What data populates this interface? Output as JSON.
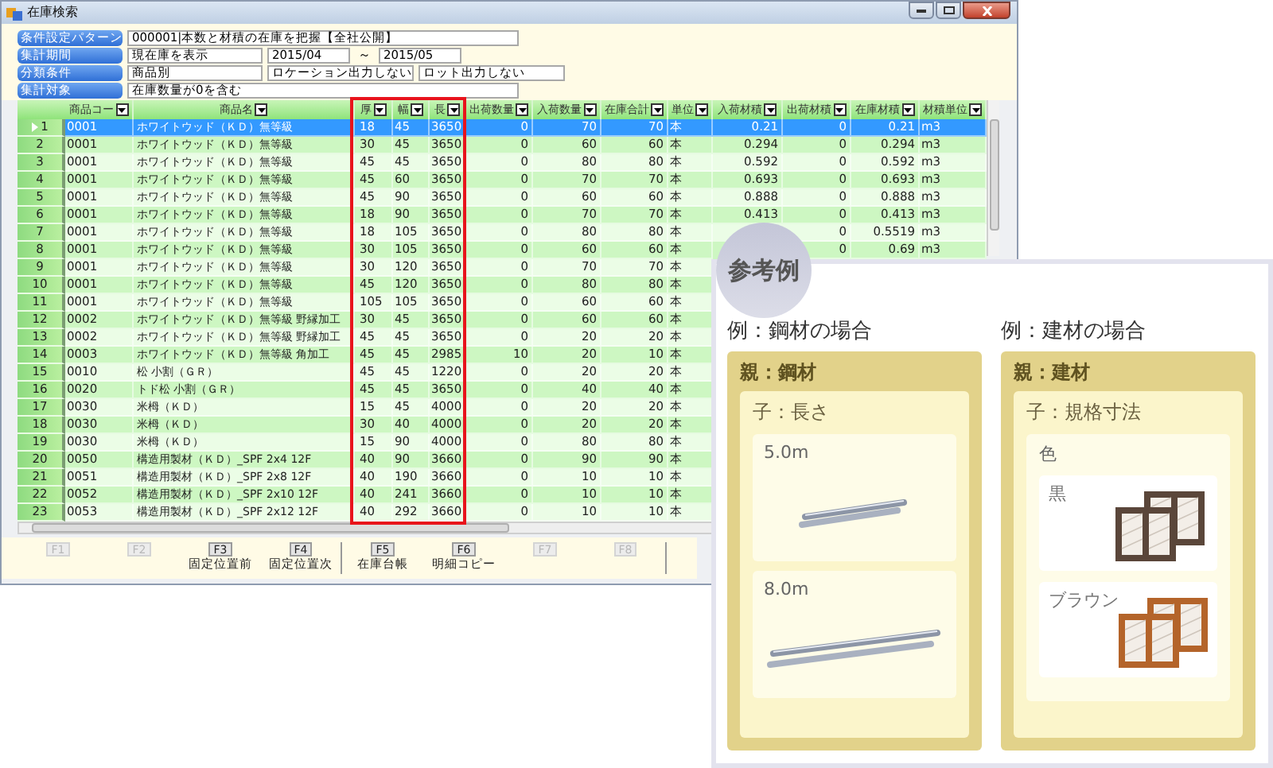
{
  "window": {
    "title": "在庫検索"
  },
  "conditions": [
    {
      "label": "条件設定パターン",
      "fields": [
        {
          "kind": "wide",
          "text": "000001|本数と材積の在庫を把握【全社公開】"
        }
      ]
    },
    {
      "label": "集計期間",
      "fields": [
        {
          "kind": "medium",
          "text": "現在庫を表示"
        },
        {
          "kind": "date",
          "text": "2015/04"
        },
        {
          "kind": "sep",
          "text": "～"
        },
        {
          "kind": "date",
          "text": "2015/05"
        }
      ]
    },
    {
      "label": "分類条件",
      "fields": [
        {
          "kind": "medium",
          "text": "商品別"
        },
        {
          "kind": "option",
          "text": "ロケーション出力しない"
        },
        {
          "kind": "option",
          "text": "ロット出力しない"
        }
      ]
    },
    {
      "label": "集計対象",
      "fields": [
        {
          "kind": "wide",
          "text": "在庫数量が0を含む"
        }
      ]
    }
  ],
  "table": {
    "columns": [
      {
        "label": "商品コー"
      },
      {
        "label": "商品名"
      },
      {
        "label": "厚"
      },
      {
        "label": "幅"
      },
      {
        "label": "長"
      },
      {
        "label": "出荷数量"
      },
      {
        "label": "入荷数量"
      },
      {
        "label": "在庫合計"
      },
      {
        "label": "単位"
      },
      {
        "label": "入荷材積"
      },
      {
        "label": "出荷材積"
      },
      {
        "label": "在庫材積"
      },
      {
        "label": "材積単位"
      }
    ],
    "rows": [
      {
        "no": "1",
        "selected": true,
        "cells": [
          "0001",
          "ホワイトウッド（ＫＤ）無等級",
          "18",
          "45",
          "3650",
          "0",
          "70",
          "70",
          "本",
          "0.21",
          "0",
          "0.21",
          "m3"
        ]
      },
      {
        "no": "2",
        "selected": false,
        "cells": [
          "0001",
          "ホワイトウッド（ＫＤ）無等級",
          "30",
          "45",
          "3650",
          "0",
          "60",
          "60",
          "本",
          "0.294",
          "0",
          "0.294",
          "m3"
        ]
      },
      {
        "no": "3",
        "selected": false,
        "cells": [
          "0001",
          "ホワイトウッド（ＫＤ）無等級",
          "45",
          "45",
          "3650",
          "0",
          "80",
          "80",
          "本",
          "0.592",
          "0",
          "0.592",
          "m3"
        ]
      },
      {
        "no": "4",
        "selected": false,
        "cells": [
          "0001",
          "ホワイトウッド（ＫＤ）無等級",
          "45",
          "60",
          "3650",
          "0",
          "70",
          "70",
          "本",
          "0.693",
          "0",
          "0.693",
          "m3"
        ]
      },
      {
        "no": "5",
        "selected": false,
        "cells": [
          "0001",
          "ホワイトウッド（ＫＤ）無等級",
          "45",
          "90",
          "3650",
          "0",
          "60",
          "60",
          "本",
          "0.888",
          "0",
          "0.888",
          "m3"
        ]
      },
      {
        "no": "6",
        "selected": false,
        "cells": [
          "0001",
          "ホワイトウッド（ＫＤ）無等級",
          "18",
          "90",
          "3650",
          "0",
          "70",
          "70",
          "本",
          "0.413",
          "0",
          "0.413",
          "m3"
        ]
      },
      {
        "no": "7",
        "selected": false,
        "cells": [
          "0001",
          "ホワイトウッド（ＫＤ）無等級",
          "18",
          "105",
          "3650",
          "0",
          "80",
          "80",
          "本",
          null,
          "0",
          "0.5519",
          "m3"
        ]
      },
      {
        "no": "8",
        "selected": false,
        "cells": [
          "0001",
          "ホワイトウッド（ＫＤ）無等級",
          "30",
          "105",
          "3650",
          "0",
          "60",
          "60",
          "本",
          null,
          "0",
          "0.69",
          "m3"
        ]
      },
      {
        "no": "9",
        "selected": false,
        "cells": [
          "0001",
          "ホワイトウッド（ＫＤ）無等級",
          "30",
          "120",
          "3650",
          "0",
          "70",
          "70",
          "本"
        ]
      },
      {
        "no": "10",
        "selected": false,
        "cells": [
          "0001",
          "ホワイトウッド（ＫＤ）無等級",
          "45",
          "120",
          "3650",
          "0",
          "80",
          "80",
          "本"
        ]
      },
      {
        "no": "11",
        "selected": false,
        "cells": [
          "0001",
          "ホワイトウッド（ＫＤ）無等級",
          "105",
          "105",
          "3650",
          "0",
          "60",
          "60",
          "本"
        ]
      },
      {
        "no": "12",
        "selected": false,
        "cells": [
          "0002",
          "ホワイトウッド（ＫＤ）無等級 野縁加工",
          "30",
          "45",
          "3650",
          "0",
          "60",
          "60",
          "本"
        ]
      },
      {
        "no": "13",
        "selected": false,
        "cells": [
          "0002",
          "ホワイトウッド（ＫＤ）無等級 野縁加工",
          "45",
          "45",
          "3650",
          "0",
          "20",
          "20",
          "本"
        ]
      },
      {
        "no": "14",
        "selected": false,
        "cells": [
          "0003",
          "ホワイトウッド（ＫＤ）無等級 角加工",
          "45",
          "45",
          "2985",
          "10",
          "20",
          "10",
          "本"
        ]
      },
      {
        "no": "15",
        "selected": false,
        "cells": [
          "0010",
          "松 小割（ＧＲ）",
          "45",
          "45",
          "1220",
          "0",
          "20",
          "20",
          "本"
        ]
      },
      {
        "no": "16",
        "selected": false,
        "cells": [
          "0020",
          "トド松 小割（ＧＲ）",
          "45",
          "45",
          "3650",
          "0",
          "40",
          "40",
          "本"
        ]
      },
      {
        "no": "17",
        "selected": false,
        "cells": [
          "0030",
          "米栂（ＫＤ）",
          "15",
          "45",
          "4000",
          "0",
          "20",
          "20",
          "本"
        ]
      },
      {
        "no": "18",
        "selected": false,
        "cells": [
          "0030",
          "米栂（ＫＤ）",
          "30",
          "40",
          "4000",
          "0",
          "20",
          "20",
          "本"
        ]
      },
      {
        "no": "19",
        "selected": false,
        "cells": [
          "0030",
          "米栂（ＫＤ）",
          "15",
          "90",
          "4000",
          "0",
          "80",
          "80",
          "本"
        ]
      },
      {
        "no": "20",
        "selected": false,
        "cells": [
          "0050",
          "構造用製材（ＫＤ）_SPF 2x4 12F",
          "40",
          "90",
          "3660",
          "0",
          "90",
          "90",
          "本"
        ]
      },
      {
        "no": "21",
        "selected": false,
        "cells": [
          "0051",
          "構造用製材（ＫＤ）_SPF 2x8 12F",
          "40",
          "190",
          "3660",
          "0",
          "10",
          "10",
          "本"
        ]
      },
      {
        "no": "22",
        "selected": false,
        "cells": [
          "0052",
          "構造用製材（ＫＤ）_SPF 2x10 12F",
          "40",
          "241",
          "3660",
          "0",
          "10",
          "10",
          "本"
        ]
      },
      {
        "no": "23",
        "selected": false,
        "cells": [
          "0053",
          "構造用製材（ＫＤ）_SPF 2x12 12F",
          "40",
          "292",
          "3660",
          "0",
          "10",
          "10",
          "本"
        ]
      }
    ]
  },
  "function_keys": [
    {
      "key": "F1",
      "disabled": true,
      "divider_after": false
    },
    {
      "key": "F2",
      "disabled": true,
      "divider_after": false
    },
    {
      "key": "F3",
      "label": "固定位置前",
      "disabled": false,
      "divider_after": false
    },
    {
      "key": "F4",
      "label": "固定位置次",
      "disabled": false,
      "divider_after": true
    },
    {
      "key": "F5",
      "label": "在庫台帳",
      "disabled": false,
      "divider_after": false
    },
    {
      "key": "F6",
      "label": "明細コピー",
      "disabled": false,
      "divider_after": false
    },
    {
      "key": "F7",
      "disabled": true,
      "divider_after": false
    },
    {
      "key": "F8",
      "disabled": true,
      "divider_after": true
    }
  ],
  "reference": {
    "badge": "参考例",
    "examples": [
      {
        "title": "例：鋼材の場合",
        "parent": "親：鋼材",
        "child": {
          "label": "子：長さ",
          "items": [
            {
              "kind": "pipe_short",
              "label": "5.0m"
            },
            {
              "kind": "pipe_long",
              "label": "8.0m"
            }
          ]
        }
      },
      {
        "title": "例：建材の場合",
        "parent": "親：建材",
        "child": {
          "label": "子：規格寸法",
          "group": {
            "label": "色",
            "items": [
              {
                "kind": "frame",
                "label": "黒",
                "color": "#5a463a"
              },
              {
                "kind": "frame",
                "label": "ブラウン",
                "color": "#b4642a"
              }
            ]
          }
        }
      }
    ]
  }
}
